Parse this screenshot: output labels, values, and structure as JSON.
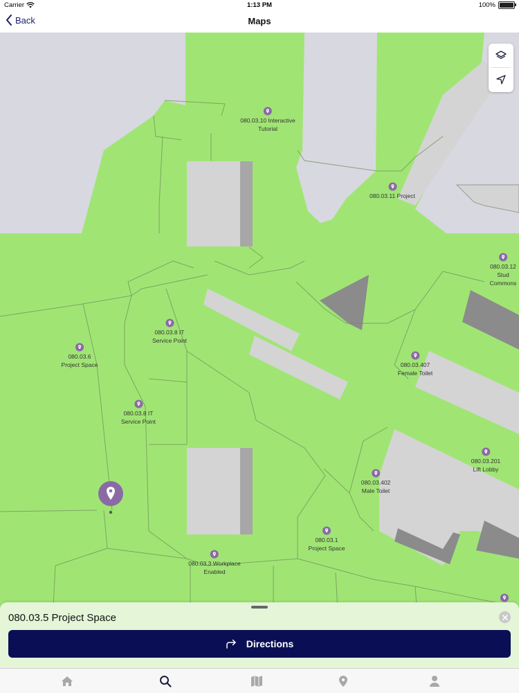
{
  "status_bar": {
    "carrier": "Carrier",
    "time": "1:13 PM",
    "battery": "100%"
  },
  "nav": {
    "back_label": "Back",
    "title": "Maps"
  },
  "map": {
    "labels": [
      {
        "text": "080.03.10 Interactive\nTutorial"
      },
      {
        "text": "080.03.11 Project"
      },
      {
        "text": "080.03.12 Stud\nCommons"
      },
      {
        "text": "080.03.8 IT\nService Point"
      },
      {
        "text": "080.03.6\nProject Space"
      },
      {
        "text": "080.03.407\nFemale Toilet"
      },
      {
        "text": "080.03.8 IT\nService Point"
      },
      {
        "text": "080.03.201\nLift Lobby"
      },
      {
        "text": "080.03.402\nMale Toilet"
      },
      {
        "text": "080.03.1\nProject Space"
      },
      {
        "text": "080.03.3 Workplace\nEnabled"
      }
    ],
    "colors": {
      "floor": "#a0e574",
      "room": "#d4d4d4",
      "shadow": "#a7a7a7",
      "pin": "#8a6aa5"
    }
  },
  "sheet": {
    "title": "080.03.5 Project Space",
    "directions_label": "Directions"
  },
  "tabs": [
    {
      "icon": "home-icon"
    },
    {
      "icon": "search-icon"
    },
    {
      "icon": "map-icon"
    },
    {
      "icon": "location-pin-icon"
    },
    {
      "icon": "person-icon"
    }
  ],
  "colors": {
    "primary": "#0a0f55",
    "nav_text": "#1a1f6b",
    "sheet_bg": "#e4f5d8"
  }
}
